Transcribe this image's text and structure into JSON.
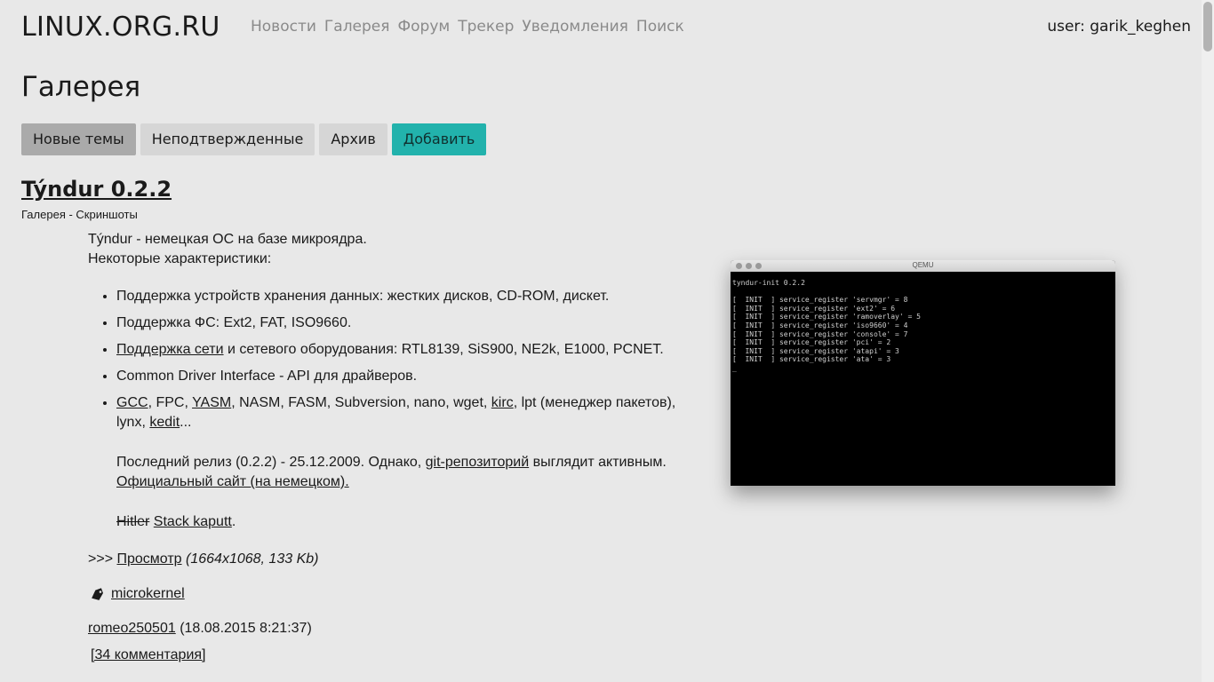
{
  "site": {
    "logo": "LINUX.ORG.RU",
    "nav": [
      "Новости",
      "Галерея",
      "Форум",
      "Трекер",
      "Уведомления",
      "Поиск"
    ],
    "user": "user: garik_keghen"
  },
  "page_title": "Галерея",
  "tabs": [
    "Новые темы",
    "Неподтвержденные",
    "Архив",
    "Добавить"
  ],
  "post": {
    "title": "Týndur 0.2.2",
    "group": "Галерея - Скриншоты",
    "intro1": "Týndur - немецкая ОС на базе микроядра.",
    "intro2": "Некоторые характеристики:",
    "li1": "Поддержка устройств хранения данных: жестких дисков, CD-ROM, дискет.",
    "li2": "Поддержка ФС: Ext2, FAT, ISO9660.",
    "li3_link": "Поддержка сети",
    "li3_rest": " и сетевого оборудования: RTL8139, SiS900, NE2k, E1000, PCNET.",
    "li4": "Common Driver Interface - API для драйверов.",
    "li5_gcc": "GCC",
    "li5_t1": ", FPC, ",
    "li5_yasm": "YASM",
    "li5_t2": ", NASM, FASM, Subversion, nano, wget, ",
    "li5_kirc": "kirc",
    "li5_t3": ", lpt (менеджер пакетов), lynx, ",
    "li5_kedit": "kedit",
    "li5_t4": "...",
    "release_text": "Последний релиз (0.2.2) - 25.12.2009. Однако, ",
    "git_link": "git-репозиторий",
    "release_tail": " выглядит активным.",
    "official_link": "Официальный сайт (на немецком).",
    "hitler": "Hitler",
    "stack_link": "Stack kaputt",
    "stack_tail": ".",
    "view_prefix": ">>> ",
    "view_link": "Просмотр",
    "view_info": "(1664x1068, 133 Kb)",
    "tag": "microkernel",
    "author": "romeo250501",
    "date": "(18.08.2015 8:21:37)",
    "comments": "[34 комментария]"
  },
  "screenshot": {
    "window_title": "QEMU",
    "lines": [
      "tyndur-init 0.2.2",
      "",
      "[  INIT  ] service_register 'servmgr' = 8",
      "[  INIT  ] service_register 'ext2' = 6",
      "[  INIT  ] service_register 'ramoverlay' = 5",
      "[  INIT  ] service_register 'iso9660' = 4",
      "[  INIT  ] service_register 'console' = 7",
      "[  INIT  ] service_register 'pci' = 2",
      "[  INIT  ] service_register 'atapi' = 3",
      "[  INIT  ] service_register 'ata' = 3",
      "_"
    ]
  }
}
